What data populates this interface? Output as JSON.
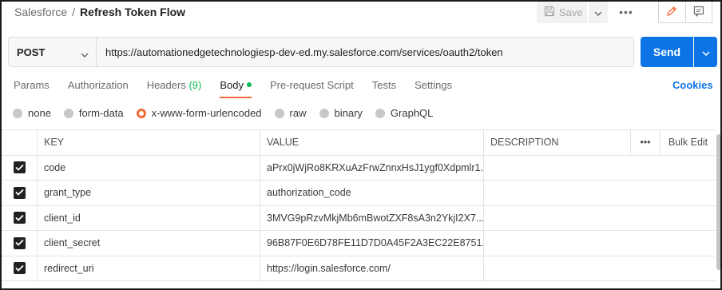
{
  "header": {
    "breadcrumb_parent": "Salesforce",
    "breadcrumb_sep": "/",
    "request_name": "Refresh Token Flow",
    "save_label": "Save",
    "more_label": "•••"
  },
  "request": {
    "method": "POST",
    "url": "https://automationedgetechnologiesp-dev-ed.my.salesforce.com/services/oauth2/token",
    "send_label": "Send"
  },
  "tabs": {
    "params": "Params",
    "authorization": "Authorization",
    "headers": "Headers",
    "headers_count": "(9)",
    "body": "Body",
    "prerequest": "Pre-request Script",
    "tests": "Tests",
    "settings": "Settings",
    "cookies": "Cookies",
    "active": "Body"
  },
  "body_types": {
    "none": "none",
    "form_data": "form-data",
    "urlencoded": "x-www-form-urlencoded",
    "raw": "raw",
    "binary": "binary",
    "graphql": "GraphQL",
    "selected": "x-www-form-urlencoded"
  },
  "table": {
    "headers": {
      "key": "KEY",
      "value": "VALUE",
      "description": "DESCRIPTION",
      "more": "•••",
      "bulk_edit": "Bulk Edit"
    },
    "rows": [
      {
        "key": "code",
        "value": "aPrx0jWjRo8KRXuAzFrwZnnxHsJ1ygf0Xdpmlr1...",
        "description": "",
        "checked": true
      },
      {
        "key": "grant_type",
        "value": "authorization_code",
        "description": "",
        "checked": true
      },
      {
        "key": "client_id",
        "value": "3MVG9pRzvMkjMb6mBwotZXF8sA3n2YkjI2X7...",
        "description": "",
        "checked": true
      },
      {
        "key": "client_secret",
        "value": "96B87F0E6D78FE11D7D0A45F2A3EC22E8751...",
        "description": "",
        "checked": true
      },
      {
        "key": "redirect_uri",
        "value": "https://login.salesforce.com/",
        "description": "",
        "checked": true
      }
    ]
  },
  "colors": {
    "accent": "#f26b3a",
    "primary": "#0d74e7",
    "success": "#0cbb52"
  }
}
